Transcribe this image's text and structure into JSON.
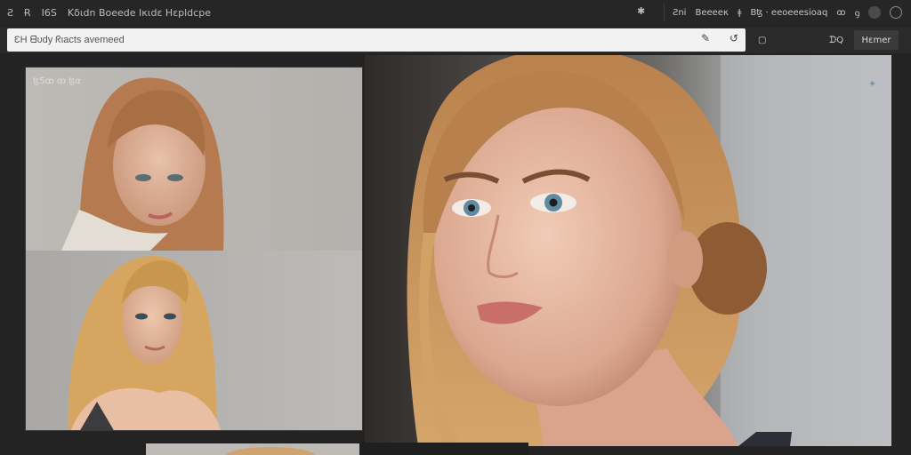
{
  "topbar": {
    "left_items": [
      "Ƨ",
      "Ɍ",
      "Ι6Ѕ",
      "Κδιdn Βoeede Ικιdε Ηεpldcpe"
    ],
    "mid_icon": "✱",
    "right_items": [
      "Ƨni",
      "Βeeeeκ",
      "ǂ",
      "Βꜩ ⋅ eeoeeesioaq",
      "ꝏ",
      "ꝯ"
    ]
  },
  "search": {
    "placeholder": "ƐΗ ᗺυdy ᖇιacts avemeed",
    "edit_icon": "✎",
    "refresh_icon": "↺",
    "square_icon": "▢",
    "control_label": "ᗪQ",
    "tool_label": "Ηεmer"
  },
  "left_panel": {
    "label": "ꜩ5ꝏ ꝏ ꜩα"
  },
  "preview": {
    "corner_icon": "✦"
  },
  "colors": {
    "background": "#232323",
    "panel": "#2e2e2e",
    "searchbox": "#f2f2f2",
    "accent_blue": "#7d93b3"
  }
}
